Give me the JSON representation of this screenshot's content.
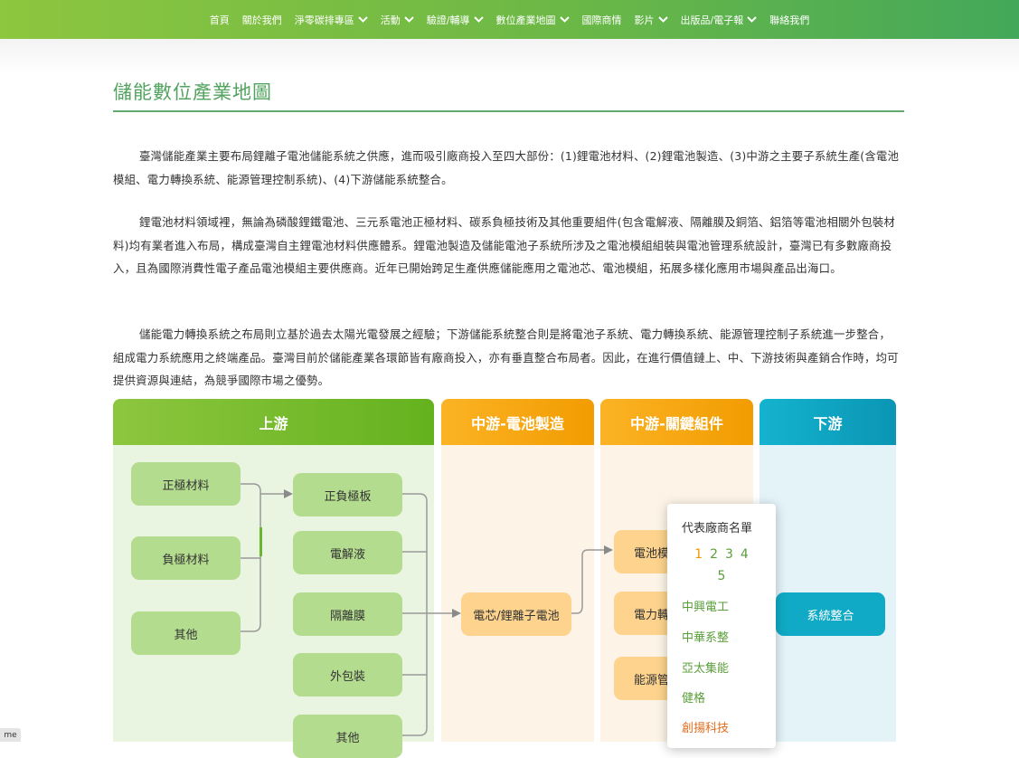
{
  "nav": {
    "items": [
      {
        "label": "首頁",
        "dropdown": false
      },
      {
        "label": "關於我們",
        "dropdown": false
      },
      {
        "label": "淨零碳排專區",
        "dropdown": true
      },
      {
        "label": "活動",
        "dropdown": true
      },
      {
        "label": "驗證/輔導",
        "dropdown": true
      },
      {
        "label": "數位產業地圖",
        "dropdown": true
      },
      {
        "label": "國際商情",
        "dropdown": false
      },
      {
        "label": "影片",
        "dropdown": true
      },
      {
        "label": "出版品/電子報",
        "dropdown": true
      },
      {
        "label": "聯絡我們",
        "dropdown": false
      }
    ]
  },
  "page": {
    "title": "儲能數位產業地圖",
    "paragraphs": [
      "臺灣儲能產業主要布局鋰離子電池儲能系統之供應，進而吸引廠商投入至四大部份：(1)鋰電池材料、(2)鋰電池製造、(3)中游之主要子系統生產(含電池模組、電力轉換系統、能源管理控制系統)、(4)下游儲能系統整合。",
      "鋰電池材料領域裡，無論為磷酸鋰鐵電池、三元系電池正極材料、碳系負極技術及其他重要組件(包含電解液、隔離膜及銅箔、鋁箔等電池相關外包裝材料)均有業者進入布局，構成臺灣自主鋰電池材料供應體系。鋰電池製造及儲能電池子系統所涉及之電池模組組裝與電池管理系統設計，臺灣已有多數廠商投入，且為國際消費性電子產品電池模組主要供應商。近年已開始跨足生產供應儲能應用之電池芯、電池模組，拓展多樣化應用市場與產品出海口。",
      "儲能電力轉換系統之布局則立基於過去太陽光電發展之經驗；下游儲能系統整合則是將電池子系統、電力轉換系統、能源管理控制子系統進一步整合，組成電力系統應用之終端產品。臺灣目前於儲能產業各環節皆有廠商投入，亦有垂直整合布局者。因此，在進行價值鏈上、中、下游技術與產銷合作時，均可提供資源與連結，為競爭國際市場之優勢。"
    ]
  },
  "map": {
    "columns": {
      "upstream": {
        "label": "上游",
        "color": "#7cbb21",
        "bg": "#eaf5e1"
      },
      "mid_cell": {
        "label": "中游-電池製造",
        "color": "#f5a500",
        "bg": "#fdf4e7"
      },
      "mid_parts": {
        "label": "中游-關鍵組件",
        "color": "#f5a500",
        "bg": "#fdf4e7"
      },
      "downstream": {
        "label": "下游",
        "color": "#0da5c0",
        "bg": "#e3f3f8"
      }
    },
    "upstream_left": [
      "正極材料",
      "負極材料",
      "其他"
    ],
    "upstream_right": [
      "正負極板",
      "電解液",
      "隔離膜",
      "外包裝",
      "其他"
    ],
    "cell": "電芯/鋰離子電池",
    "parts": [
      "電池模",
      "電力轉",
      "能源管"
    ],
    "system": "系統整合"
  },
  "popup": {
    "title": "代表廠商名單",
    "pages": [
      "1",
      "2",
      "3",
      "4",
      "5"
    ],
    "current_page": "1",
    "vendors": [
      {
        "name": "中興電工",
        "color": "#5a9e3a"
      },
      {
        "name": "中華系整",
        "color": "#5a9e3a"
      },
      {
        "name": "亞太集能",
        "color": "#5a9e3a"
      },
      {
        "name": "健格",
        "color": "#5a9e3a"
      },
      {
        "name": "創揚科技",
        "color": "#e06c1b"
      }
    ]
  },
  "badge": "me"
}
